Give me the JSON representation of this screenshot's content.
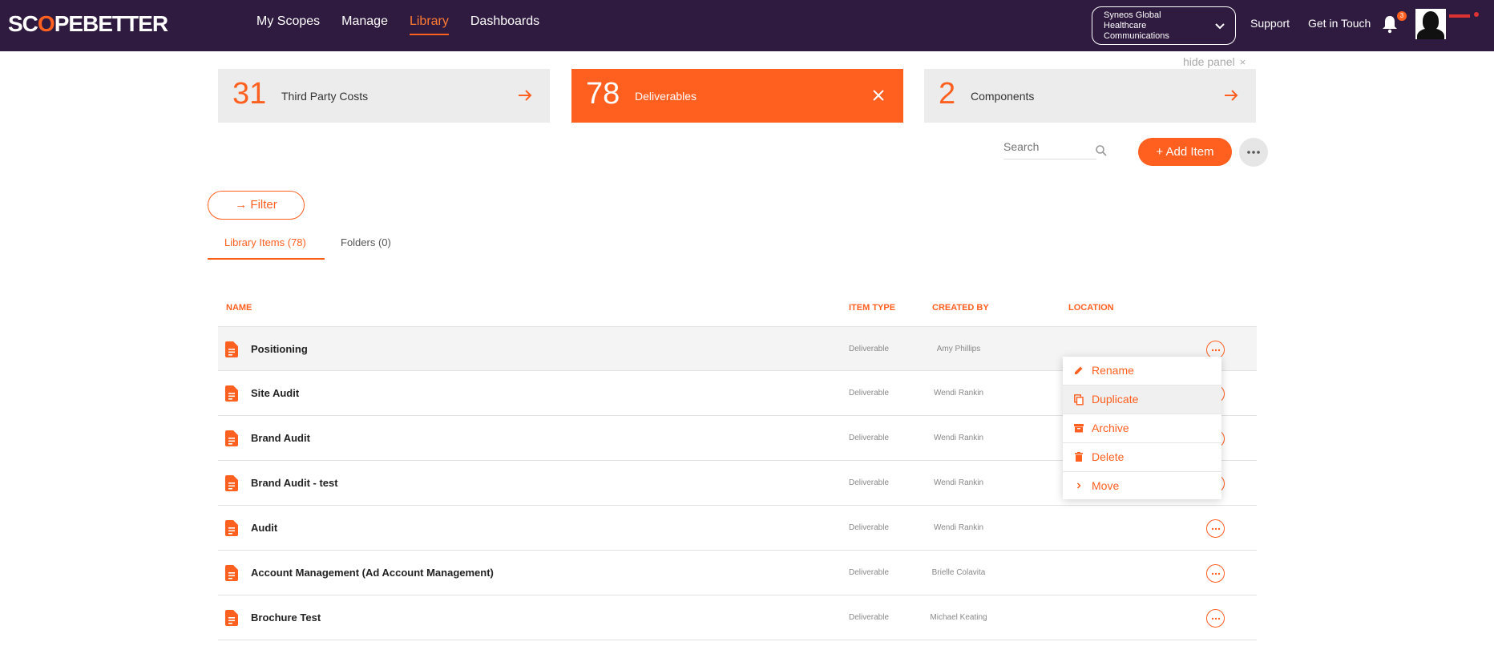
{
  "topbar": {
    "logo_main": "SC",
    "logo_o": "O",
    "logo_rest": "PEBETTER",
    "nav": [
      {
        "label": "My Scopes"
      },
      {
        "label": "Manage"
      },
      {
        "label": "Library"
      },
      {
        "label": "Dashboards"
      }
    ],
    "org_line1": "Syneos Global",
    "org_line2": "Healthcare",
    "org_line3": "Communications",
    "support": "Support",
    "get_in_touch": "Get in Touch",
    "notification_count": "3"
  },
  "hide_panel": {
    "label": "hide panel",
    "close": "×"
  },
  "stats": [
    {
      "number": "31",
      "label": "Third Party Costs"
    },
    {
      "number": "78",
      "label": "Deliverables"
    },
    {
      "number": "2",
      "label": "Components"
    }
  ],
  "toolbar": {
    "search_placeholder": "Search",
    "add_label": "+  Add Item",
    "filter_label": "→ Filter"
  },
  "tabs": [
    {
      "label": "Library Items (78)"
    },
    {
      "label": "Folders (0)"
    }
  ],
  "table": {
    "headers": {
      "name": "NAME",
      "item_type": "ITEM TYPE",
      "created_by": "CREATED BY",
      "location": "LOCATION"
    },
    "rows": [
      {
        "name": "Positioning",
        "type": "Deliverable",
        "created_by": "Amy Phillips"
      },
      {
        "name": "Site Audit",
        "type": "Deliverable",
        "created_by": "Wendi Rankin"
      },
      {
        "name": "Brand Audit",
        "type": "Deliverable",
        "created_by": "Wendi Rankin"
      },
      {
        "name": "Brand Audit - test",
        "type": "Deliverable",
        "created_by": "Wendi Rankin"
      },
      {
        "name": "Audit",
        "type": "Deliverable",
        "created_by": "Wendi Rankin"
      },
      {
        "name": "Account Management (Ad Account Management)",
        "type": "Deliverable",
        "created_by": "Brielle Colavita"
      },
      {
        "name": "Brochure Test",
        "type": "Deliverable",
        "created_by": "Michael Keating"
      }
    ]
  },
  "context_menu": {
    "items": [
      {
        "label": "Rename"
      },
      {
        "label": "Duplicate"
      },
      {
        "label": "Archive"
      },
      {
        "label": "Delete"
      },
      {
        "label": "Move"
      }
    ]
  },
  "colors": {
    "accent": "#ff5f1f",
    "topbar": "#2f1b40"
  }
}
